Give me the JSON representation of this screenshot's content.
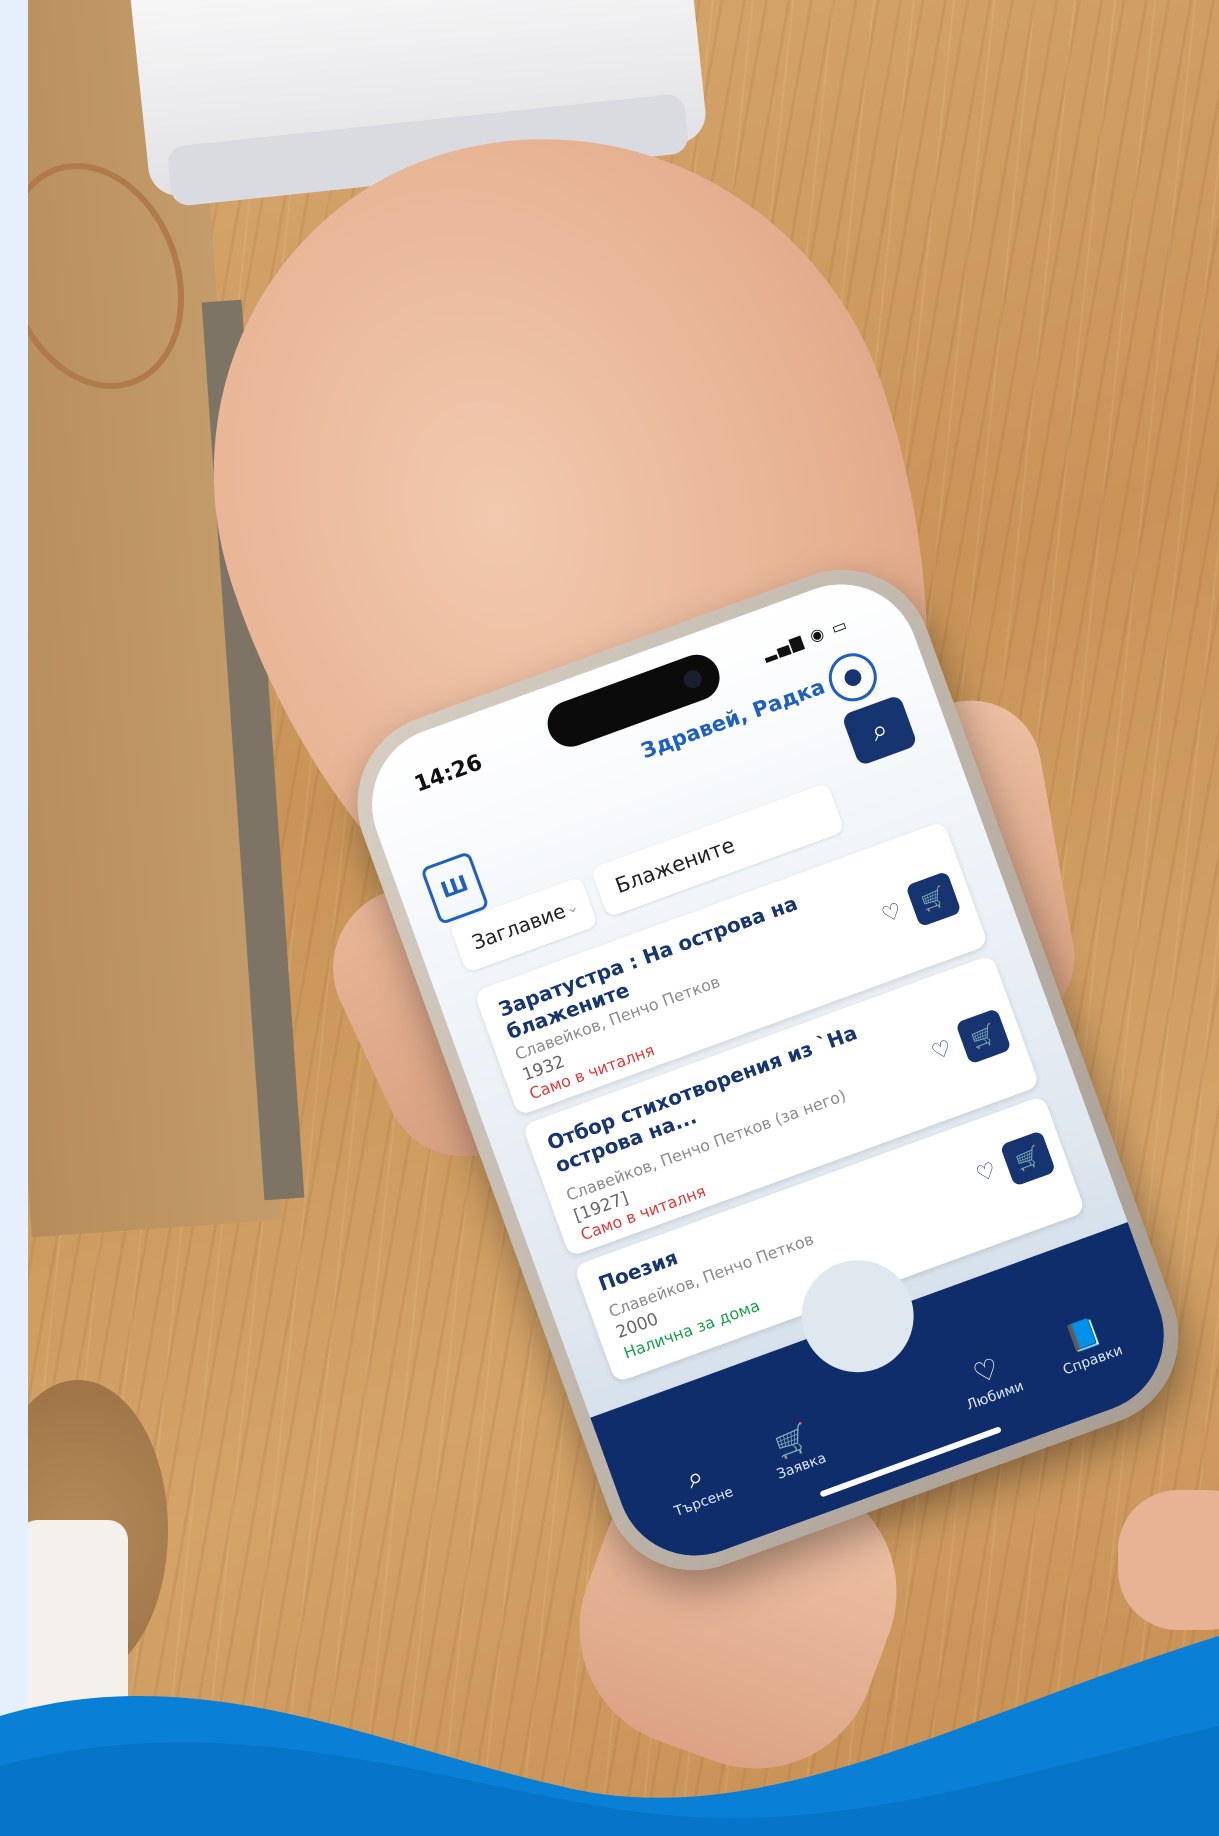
{
  "status_bar": {
    "time": "14:26",
    "signal_icons": "signal-wifi-battery"
  },
  "header": {
    "greeting": "Здравей, Радка",
    "user_icon": "user-circle-icon",
    "logo_icon": "library-logo-icon"
  },
  "search": {
    "field_select": "Заглавие",
    "query": "Блажените",
    "button_icon": "search-icon"
  },
  "results": [
    {
      "title": "Заратустра : На острова на блажените",
      "author": "Славейков, Пенчо Петков",
      "year": "1932",
      "availability": "Само в читалня",
      "status": "red"
    },
    {
      "title": "Отбор стихотворения из `На острова на...",
      "author": "Славейков, Пенчо Петков (за него)",
      "year": "[1927]",
      "availability": "Само в читалня",
      "status": "red"
    },
    {
      "title": "Поезия",
      "author": "Славейков, Пенчо Петков",
      "year": "2000",
      "availability": "Налична за дома",
      "status": "green"
    }
  ],
  "bottom_nav": {
    "items": [
      {
        "label": "Търсене",
        "icon": "search-icon"
      },
      {
        "label": "Заявка",
        "icon": "cart-icon"
      },
      {
        "label": "Любими",
        "icon": "heart-icon"
      },
      {
        "label": "Справки",
        "icon": "book-icon"
      }
    ],
    "center_button_icon": "library-card-icon"
  },
  "colors": {
    "primary_navy": "#16346f",
    "accent_blue": "#1f5fbf",
    "status_red": "#e0393a",
    "status_green": "#1aa04a",
    "wave_blue": "#0a7fd6"
  }
}
